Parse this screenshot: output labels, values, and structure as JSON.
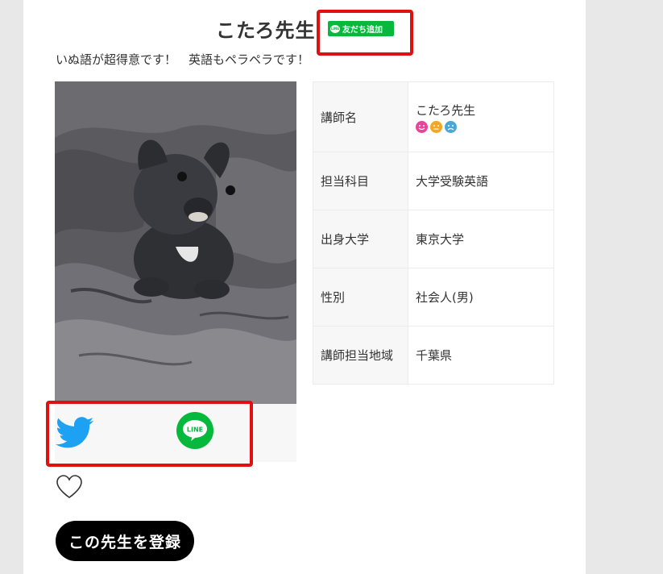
{
  "header": {
    "title": "こたろ先生",
    "friend_add_label": "友だち追加",
    "line_mini_label": "LINE"
  },
  "intro": "いぬ語が超得意です！　英語もペラペラです！",
  "profile_table": {
    "rows": [
      {
        "key": "講師名",
        "value": "こたろ先生"
      },
      {
        "key": "担当科目",
        "value": "大学受験英語"
      },
      {
        "key": "出身大学",
        "value": "東京大学"
      },
      {
        "key": "性別",
        "value": "社会人(男)"
      },
      {
        "key": "講師担当地域",
        "value": "千葉県"
      }
    ],
    "face_icons": [
      "smile-face-icon",
      "neutral-face-icon",
      "sad-face-icon"
    ],
    "face_colors": [
      "#e8449c",
      "#f5a623",
      "#4aa8d8"
    ]
  },
  "share": {
    "twitter_icon": "twitter-bird-icon",
    "line_icon_label": "LINE",
    "twitter_color": "#1da1f2",
    "line_color": "#06b93c"
  },
  "favorite_icon": "heart-outline-icon",
  "register_button": "この先生を登録",
  "photo_alt": "puppy-photo",
  "colors": {
    "page_bg": "#e8e8e8",
    "card_bg": "#ffffff",
    "highlight": "#e11010"
  }
}
